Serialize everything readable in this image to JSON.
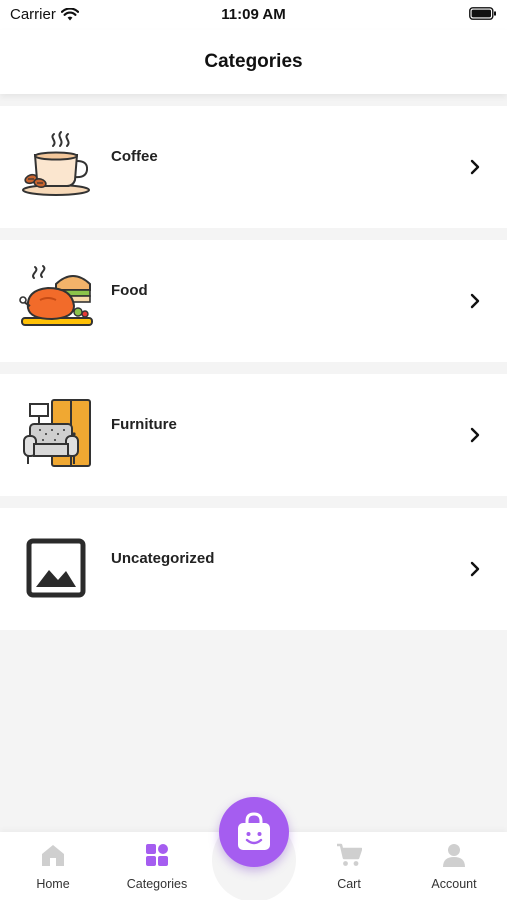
{
  "status_bar": {
    "carrier": "Carrier",
    "time": "11:09 AM"
  },
  "header": {
    "title": "Categories"
  },
  "categories": [
    {
      "label": "Coffee",
      "icon": "coffee-cup-icon"
    },
    {
      "label": "Food",
      "icon": "roast-chicken-icon"
    },
    {
      "label": "Furniture",
      "icon": "sofa-icon"
    },
    {
      "label": "Uncategorized",
      "icon": "image-placeholder-icon"
    }
  ],
  "tab_bar": {
    "items": [
      {
        "label": "Home",
        "icon": "home-icon",
        "active": false
      },
      {
        "label": "Categories",
        "icon": "categories-grid-icon",
        "active": true
      },
      {
        "label": "Cart",
        "icon": "cart-icon",
        "active": false
      },
      {
        "label": "Account",
        "icon": "account-icon",
        "active": false
      }
    ],
    "center_button_icon": "shopping-bag-smile-icon"
  },
  "colors": {
    "accent": "#a55df0",
    "inactive_icon": "#cfcfcf"
  }
}
